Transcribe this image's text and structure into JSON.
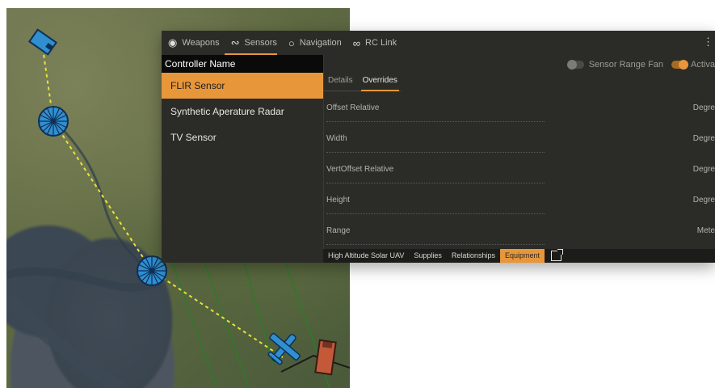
{
  "tabs": [
    {
      "label": "Weapons",
      "icon": "weapons-icon"
    },
    {
      "label": "Sensors",
      "icon": "sensors-icon"
    },
    {
      "label": "Navigation",
      "icon": "navigation-icon"
    },
    {
      "label": "RC Link",
      "icon": "link-icon"
    }
  ],
  "controllers": {
    "header": "Controller Name",
    "items": [
      "FLIR Sensor",
      "Synthetic Aperature Radar",
      "TV Sensor"
    ],
    "selected": "FLIR Sensor"
  },
  "toggles": {
    "sensor_range_fan": "Sensor Range Fan",
    "active": "Activa"
  },
  "subtabs": [
    "Details",
    "Overrides"
  ],
  "fields": [
    {
      "label": "Offset Relative",
      "unit": "Degre"
    },
    {
      "label": "Width",
      "unit": "Degre"
    },
    {
      "label": "VertOffset Relative",
      "unit": "Degre"
    },
    {
      "label": "Height",
      "unit": "Degre"
    },
    {
      "label": "Range",
      "unit": "Mete"
    }
  ],
  "bottom_tabs": [
    "High Altitude Solar UAV",
    "Supplies",
    "Relationships",
    "Equipment"
  ],
  "colors": {
    "accent": "#e8963a",
    "route": "#e8e23a",
    "unit_blue": "#2f8fd0",
    "unit_red": "#c4593a"
  }
}
